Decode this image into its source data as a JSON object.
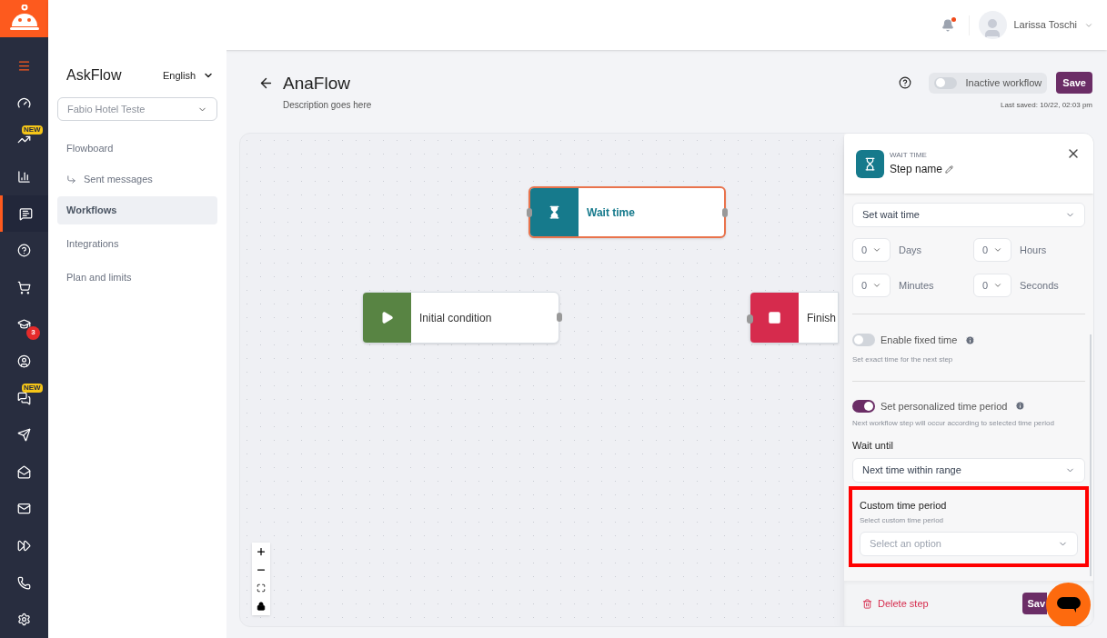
{
  "header": {
    "notification_unread": true,
    "user_name": "Larissa Toschi"
  },
  "rail": {
    "items": [
      {
        "selected": false
      },
      {
        "selected": false
      },
      {
        "selected": false,
        "badge": "NEW",
        "kind": "new"
      },
      {
        "selected": false
      },
      {
        "selected": true
      },
      {
        "selected": false
      },
      {
        "selected": false
      },
      {
        "selected": false,
        "badge": "3",
        "kind": "count"
      },
      {
        "selected": false
      },
      {
        "selected": false,
        "badge": "NEW",
        "kind": "new"
      },
      {
        "selected": false
      },
      {
        "selected": false
      },
      {
        "selected": false
      },
      {
        "selected": false
      },
      {
        "selected": false
      },
      {
        "selected": false
      }
    ]
  },
  "sidebar": {
    "title": "AskFlow",
    "language": "English",
    "account": "Fabio Hotel Teste",
    "items": [
      {
        "label": "Flowboard",
        "selected": false,
        "children": [
          {
            "label": "Sent messages",
            "selected": false
          }
        ]
      },
      {
        "label": "Workflows",
        "selected": true
      },
      {
        "label": "Integrations",
        "selected": false
      },
      {
        "label": "Plan and limits",
        "selected": false
      }
    ]
  },
  "workflow": {
    "title": "AnaFlow",
    "description": "Description goes here",
    "active": false,
    "status_label": "Inactive workflow",
    "save": "Save",
    "last_saved": "Last saved: 10/22, 02:03 pm"
  },
  "canvas": {
    "nodes": [
      {
        "kind": "wait",
        "label": "Wait time",
        "selected": true
      },
      {
        "kind": "start",
        "label": "Initial condition",
        "selected": false
      },
      {
        "kind": "finish",
        "label": "Finish",
        "selected": false
      }
    ]
  },
  "panel": {
    "type_label": "WAIT TIME",
    "step_name": "Step name",
    "wait_select": "Set wait time",
    "durations": [
      {
        "value": "0",
        "unit": "Days"
      },
      {
        "value": "0",
        "unit": "Hours"
      },
      {
        "value": "0",
        "unit": "Minutes"
      },
      {
        "value": "0",
        "unit": "Seconds"
      }
    ],
    "fixed_time": {
      "label": "Enable fixed time",
      "on": false,
      "hint": "Set exact time for the next step"
    },
    "personalized": {
      "label": "Set personalized time period",
      "on": true,
      "hint": "Next workflow step will occur according to selected time period"
    },
    "wait_until": {
      "label": "Wait until",
      "value": "Next time within range"
    },
    "custom_period": {
      "label": "Custom time period",
      "hint": "Select custom time period",
      "placeholder": "Select an option",
      "highlighted": true
    },
    "delete": "Delete step",
    "save": "Sav"
  }
}
